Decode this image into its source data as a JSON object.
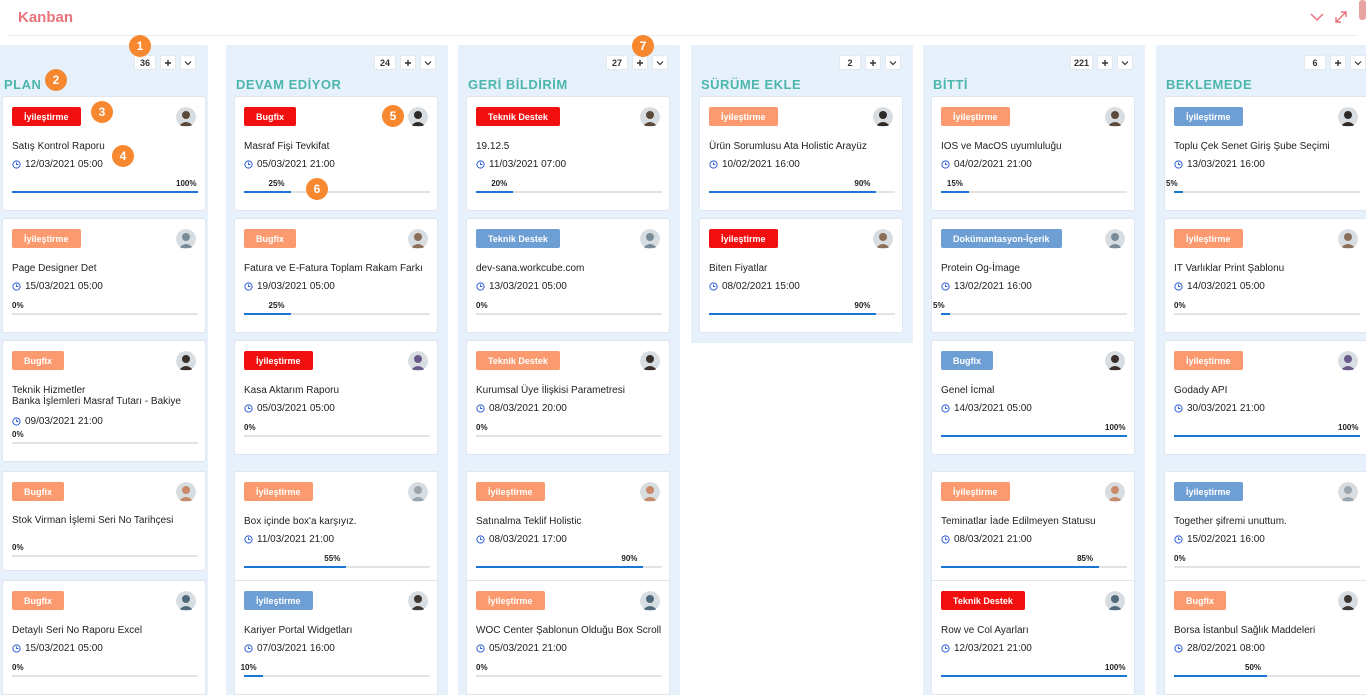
{
  "app": {
    "title": "Kanban"
  },
  "markers": [
    "1",
    "2",
    "3",
    "4",
    "5",
    "6",
    "7"
  ],
  "colors": {
    "title": "#e8737a",
    "column_title": "#4db6ac",
    "column_bg": "#e7f1fc",
    "progress": "#1976d2",
    "tag_red": "#f10f0f",
    "tag_orange": "#fa9a6e",
    "tag_blue": "#6d9ed4",
    "marker": "#f7882f"
  },
  "icons": {
    "collapse": "chevron-down-icon",
    "expand": "expand-icon",
    "add": "plus-icon",
    "menu": "chevron-down-icon",
    "date": "clock-icon"
  },
  "columns": [
    {
      "title": "PLAN",
      "count": "36",
      "cards": [
        {
          "tag": "İyileştirme",
          "tag_color": "red",
          "title": "Satış Kontrol Raporu",
          "date": "12/03/2021 05:00",
          "progress": "100%"
        },
        {
          "tag": "İyileştirme",
          "tag_color": "orange",
          "title": "Page Designer Det",
          "date": "15/03/2021 05:00",
          "progress": "0%"
        },
        {
          "tag": "Bugfix",
          "tag_color": "orange",
          "title": "Teknik Hizmetler",
          "title2": "Banka İşlemleri Masraf Tutarı - Bakiye",
          "date": "09/03/2021 21:00",
          "progress": "0%"
        },
        {
          "tag": "Bugfix",
          "tag_color": "orange",
          "title": "Stok Virman İşlemi Seri No Tarihçesi",
          "date": "",
          "progress": "0%"
        },
        {
          "tag": "Bugfix",
          "tag_color": "orange",
          "title": "Detaylı Seri No Raporu Excel",
          "date": "15/03/2021 05:00",
          "progress": "0%"
        }
      ]
    },
    {
      "title": "DEVAM EDİYOR",
      "count": "24",
      "cards": [
        {
          "tag": "Bugfix",
          "tag_color": "red",
          "title": "Masraf Fişi Tevkifat",
          "date": "05/03/2021 21:00",
          "progress": "25%"
        },
        {
          "tag": "Bugfix",
          "tag_color": "orange",
          "title": "Fatura ve E-Fatura Toplam Rakam Farkı",
          "date": "19/03/2021 05:00",
          "progress": "25%"
        },
        {
          "tag": "İyileştirme",
          "tag_color": "red",
          "title": "Kasa Aktarım Raporu",
          "date": "05/03/2021 05:00",
          "progress": "0%"
        },
        {
          "tag": "İyileştirme",
          "tag_color": "orange",
          "title": "Box içinde box'a karşıyız.",
          "date": "11/03/2021 21:00",
          "progress": "55%"
        },
        {
          "tag": "İyileştirme",
          "tag_color": "blue",
          "title": "Kariyer Portal Widgetları",
          "date": "07/03/2021 16:00",
          "progress": "10%"
        }
      ]
    },
    {
      "title": "GERİ BİLDİRİM",
      "count": "27",
      "cards": [
        {
          "tag": "Teknik Destek",
          "tag_color": "red",
          "title": "19.12.5",
          "date": "11/03/2021 07:00",
          "progress": "20%"
        },
        {
          "tag": "Teknik Destek",
          "tag_color": "blue",
          "title": "dev-sana.workcube.com",
          "date": "13/03/2021 05:00",
          "progress": "0%"
        },
        {
          "tag": "Teknik Destek",
          "tag_color": "orange",
          "title": "Kurumsal Üye İlişkisi Parametresi",
          "date": "08/03/2021 20:00",
          "progress": "0%"
        },
        {
          "tag": "İyileştirme",
          "tag_color": "orange",
          "title": "Satınalma Teklif Holistic",
          "date": "08/03/2021 17:00",
          "progress": "90%"
        },
        {
          "tag": "İyileştirme",
          "tag_color": "orange",
          "title": "WOC Center Şablonun Olduğu Box Scroll",
          "date": "05/03/2021 21:00",
          "progress": "0%"
        }
      ]
    },
    {
      "title": "SÜRÜME EKLE",
      "count": "2",
      "cards": [
        {
          "tag": "İyileştirme",
          "tag_color": "orange",
          "title": "Ürün Sorumlusu Ata Holistic Arayüz",
          "date": "10/02/2021 16:00",
          "progress": "90%"
        },
        {
          "tag": "İyileştirme",
          "tag_color": "red",
          "title": "Biten Fiyatlar",
          "date": "08/02/2021 15:00",
          "progress": "90%"
        }
      ]
    },
    {
      "title": "BİTTİ",
      "count": "221",
      "cards": [
        {
          "tag": "İyileştirme",
          "tag_color": "orange",
          "title": "IOS ve MacOS uyumluluğu",
          "date": "04/02/2021 21:00",
          "progress": "15%"
        },
        {
          "tag": "Dokümantasyon-İçerik",
          "tag_color": "blue",
          "title": "Protein Og-İmage",
          "date": "13/02/2021 16:00",
          "progress": "5%"
        },
        {
          "tag": "Bugfix",
          "tag_color": "blue",
          "title": "Genel İcmal",
          "date": "14/03/2021 05:00",
          "progress": "100%"
        },
        {
          "tag": "İyileştirme",
          "tag_color": "orange",
          "title": "Teminatlar İade Edilmeyen Statusu",
          "date": "08/03/2021 21:00",
          "progress": "85%"
        },
        {
          "tag": "Teknik Destek",
          "tag_color": "red",
          "title": "Row ve Col Ayarları",
          "date": "12/03/2021 21:00",
          "progress": "100%"
        }
      ]
    },
    {
      "title": "BEKLEMEDE",
      "count": "6",
      "cards": [
        {
          "tag": "İyileştirme",
          "tag_color": "blue",
          "title": "Toplu Çek Senet Giriş Şube Seçimi",
          "date": "13/03/2021 16:00",
          "progress": "5%"
        },
        {
          "tag": "İyileştirme",
          "tag_color": "orange",
          "title": "IT Varlıklar Print Şablonu",
          "date": "14/03/2021 05:00",
          "progress": "0%"
        },
        {
          "tag": "İyileştirme",
          "tag_color": "orange",
          "title": "Godady API",
          "date": "30/03/2021 21:00",
          "progress": "100%"
        },
        {
          "tag": "İyileştirme",
          "tag_color": "blue",
          "title": "Together şifremi unuttum.",
          "date": "15/02/2021 16:00",
          "progress": "0%"
        },
        {
          "tag": "Bugfix",
          "tag_color": "orange",
          "title": "Borsa İstanbul Sağlık Maddeleri",
          "date": "28/02/2021 08:00",
          "progress": "50%"
        }
      ]
    }
  ]
}
